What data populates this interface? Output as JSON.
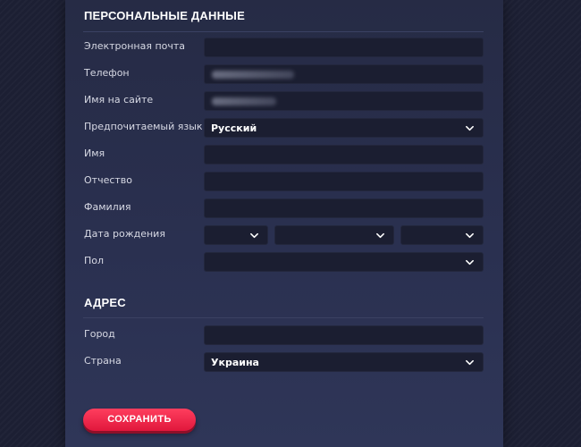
{
  "personal": {
    "title": "ПЕРСОНАЛЬНЫЕ ДАННЫЕ",
    "email_label": "Электронная почта",
    "email_value": "",
    "phone_label": "Телефон",
    "username_label": "Имя на сайте",
    "language_label": "Предпочитаемый язык",
    "language_value": "Русский",
    "first_name_label": "Имя",
    "first_name_value": "",
    "patronymic_label": "Отчество",
    "patronymic_value": "",
    "last_name_label": "Фамилия",
    "last_name_value": "",
    "birth_date_label": "Дата рождения",
    "birth_day_value": "",
    "birth_month_value": "",
    "birth_year_value": "",
    "gender_label": "Пол",
    "gender_value": ""
  },
  "address": {
    "title": "АДРЕС",
    "city_label": "Город",
    "city_value": "",
    "country_label": "Страна",
    "country_value": "Украина"
  },
  "actions": {
    "save_label": "СОХРАНИТЬ"
  },
  "icons": {
    "select_arrow": "chevron-down-icon"
  },
  "colors": {
    "accent": "#f0224a",
    "panel": "#2a3050",
    "field": "#1b1e31",
    "background": "#1c1f33"
  }
}
